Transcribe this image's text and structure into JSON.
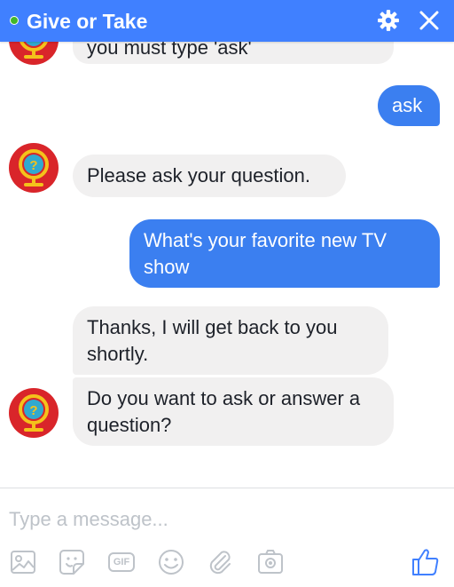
{
  "header": {
    "title": "Give or Take",
    "accent_color": "#4080ff",
    "status_icon": "online-dot",
    "settings_icon": "gear-icon",
    "close_icon": "close-icon"
  },
  "messages": [
    {
      "sender": "them",
      "text": "you must type 'ask'"
    },
    {
      "sender": "me",
      "text": "ask"
    },
    {
      "sender": "them",
      "text": "Please ask your question."
    },
    {
      "sender": "me",
      "text": "What's your favorite new TV show"
    },
    {
      "sender": "them",
      "text": "Thanks, I will get back to you shortly."
    },
    {
      "sender": "them",
      "text": "Do you want to ask or answer a question?"
    }
  ],
  "composer": {
    "placeholder": "Type a message...",
    "gif_label": "GIF",
    "tools": [
      "image-icon",
      "sticker-icon",
      "gif-icon",
      "emoji-icon",
      "attachment-icon",
      "camera-icon",
      "like-icon"
    ]
  },
  "colors": {
    "outgoing_bubble": "#3b7ff0",
    "incoming_bubble": "#f1f0f0",
    "like_blue": "#4080ff"
  }
}
